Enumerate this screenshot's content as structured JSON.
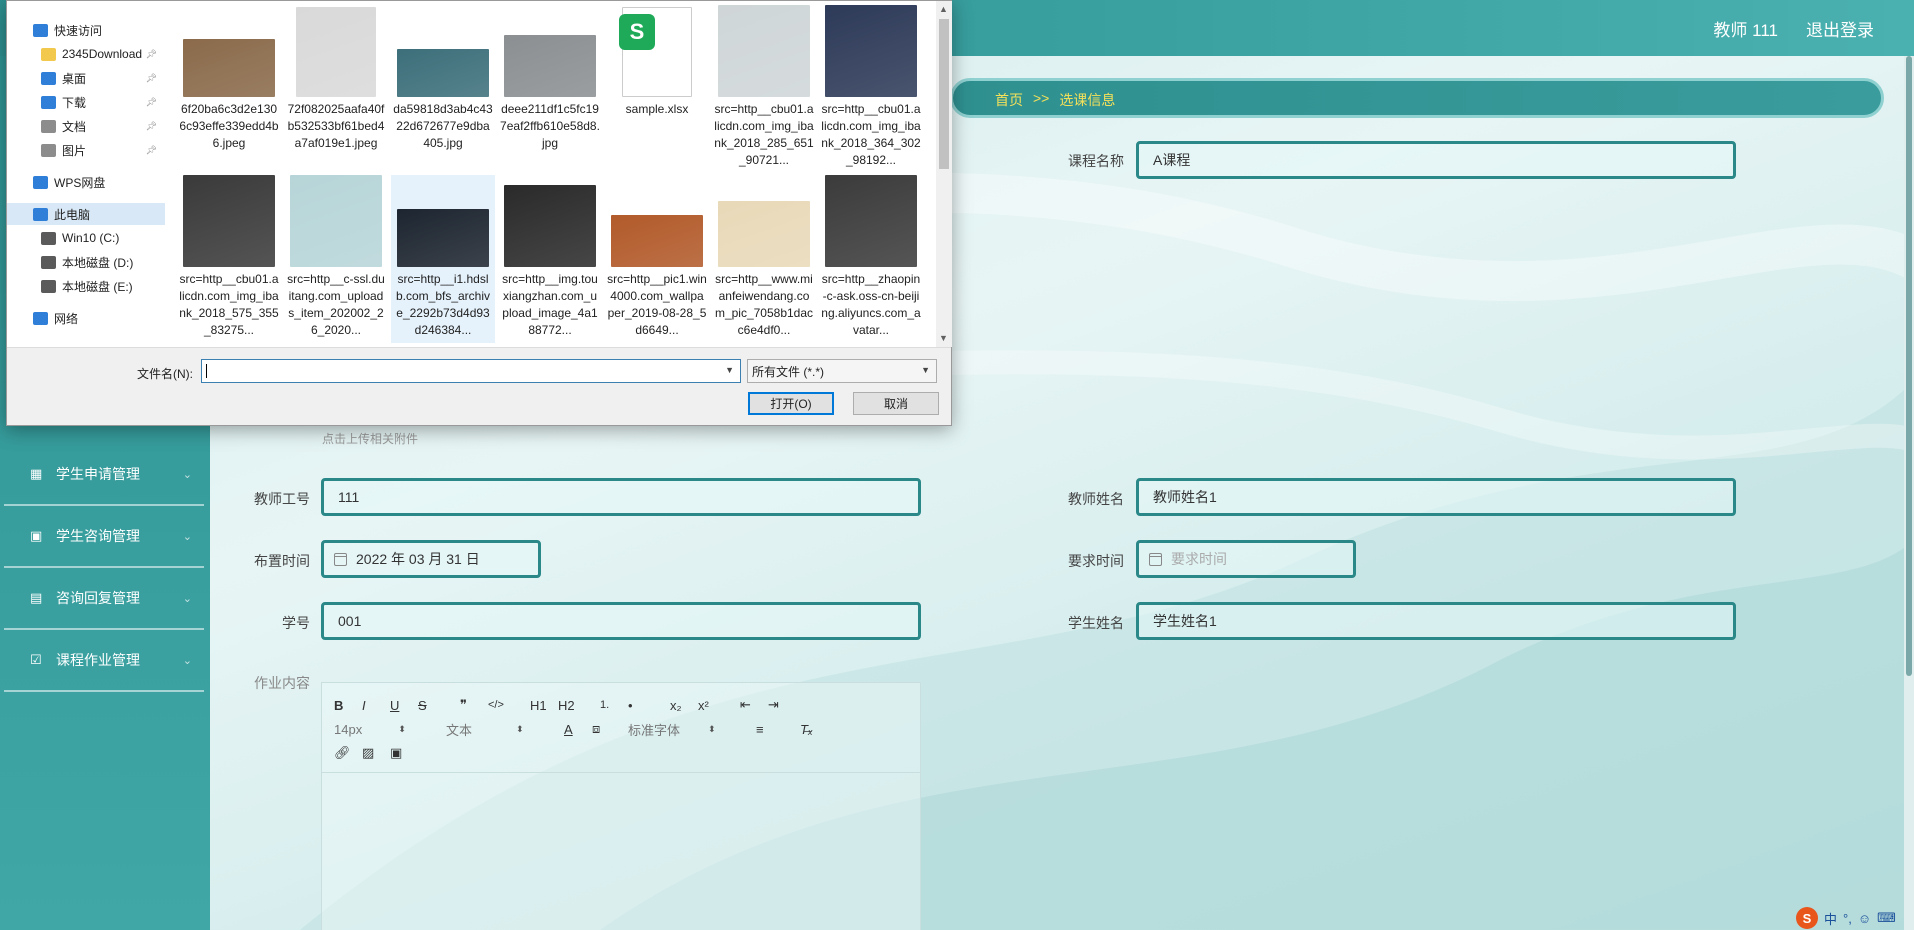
{
  "header": {
    "user_label": "教师 111",
    "logout_label": "退出登录"
  },
  "breadcrumb": {
    "home": "首页",
    "sep": ">>",
    "current": "选课信息"
  },
  "sidebar": {
    "items": [
      {
        "label": "学生申请管理"
      },
      {
        "label": "学生咨询管理"
      },
      {
        "label": "咨询回复管理"
      },
      {
        "label": "课程作业管理"
      }
    ]
  },
  "form": {
    "course_name_label": "课程名称",
    "course_name_value": "A课程",
    "upload_hint": "点击上传相关附件",
    "teacher_no_label": "教师工号",
    "teacher_no_value": "111",
    "teacher_name_label": "教师姓名",
    "teacher_name_value": "教师姓名1",
    "assign_time_label": "布置时间",
    "assign_time_value": "2022 年 03 月 31 日",
    "require_time_label": "要求时间",
    "require_time_placeholder": "要求时间",
    "student_no_label": "学号",
    "student_no_value": "001",
    "student_name_label": "学生姓名",
    "student_name_value": "学生姓名1",
    "content_label": "作业内容"
  },
  "editor": {
    "font_size": "14px",
    "text_type": "文本",
    "font_family": "标准字体",
    "buttons_row1": [
      "B",
      "I",
      "U",
      "S",
      "❞",
      "</>",
      "H1",
      "H2",
      "1.",
      "•",
      "x₂",
      "x²",
      "⇤",
      "⇥"
    ],
    "buttons_row3": [
      "link",
      "image",
      "video"
    ]
  },
  "dialog": {
    "nav": [
      {
        "label": "快速访问",
        "icon": "star-icon",
        "color": "#2f7ed8"
      },
      {
        "label": "2345Download",
        "icon": "folder-icon",
        "color": "#f2c94c",
        "pinned": true
      },
      {
        "label": "桌面",
        "icon": "desktop-icon",
        "color": "#2f7ed8",
        "pinned": true
      },
      {
        "label": "下载",
        "icon": "download-icon",
        "color": "#2f7ed8",
        "pinned": true
      },
      {
        "label": "文档",
        "icon": "document-icon",
        "color": "#8c8c8c",
        "pinned": true
      },
      {
        "label": "图片",
        "icon": "picture-icon",
        "color": "#8c8c8c",
        "pinned": true
      },
      {
        "label": "WPS网盘",
        "icon": "cloud-icon",
        "color": "#2f7ed8"
      },
      {
        "label": "此电脑",
        "icon": "computer-icon",
        "color": "#2f7ed8"
      },
      {
        "label": "Win10 (C:)",
        "icon": "drive-icon",
        "color": "#5a5a5a"
      },
      {
        "label": "本地磁盘 (D:)",
        "icon": "drive-icon",
        "color": "#5a5a5a"
      },
      {
        "label": "本地磁盘 (E:)",
        "icon": "drive-icon",
        "color": "#5a5a5a"
      },
      {
        "label": "网络",
        "icon": "network-icon",
        "color": "#2f7ed8"
      }
    ],
    "files": [
      {
        "name": "6f20ba6c3d2e1306c93effe339edd4b6.jpeg",
        "color": "#8a6a4a"
      },
      {
        "name": "72f082025aafa40fb532533bf61bed4a7af019e1.jpeg",
        "color": "#d9d9d9"
      },
      {
        "name": "da59818d3ab4c4322d672677e9dba405.jpg",
        "color": "#3c6f7a"
      },
      {
        "name": "deee211df1c5fc197eaf2ffb610e58d8.jpg",
        "color": "#8b8f92"
      },
      {
        "name": "sample.xlsx",
        "color": "#1faa59"
      },
      {
        "name": "src=http__cbu01.alicdn.com_img_ibank_2018_285_651_90721...",
        "color": "#cfd6d8"
      },
      {
        "name": "src=http__cbu01.alicdn.com_img_ibank_2018_364_302_98192...",
        "color": "#2d3a58"
      },
      {
        "name": "src=http__cbu01.alicdn.com_img_ibank_2018_575_355_83275...",
        "color": "#3a3a3a"
      },
      {
        "name": "src=http__c-ssl.duitang.com_uploads_item_202002_26_2020...",
        "color": "#b7d5d8"
      },
      {
        "name": "src=http__i1.hdslb.com_bfs_archive_2292b73d4d93d246384...",
        "color": "#1d2530"
      },
      {
        "name": "src=http__img.touxiangzhan.com_upload_image_4a188772...",
        "color": "#2a2a2a"
      },
      {
        "name": "src=http__pic1.win4000.com_wallpaper_2019-08-28_5d6649...",
        "color": "#b25a2a"
      },
      {
        "name": "src=http__www.mianfeiwendang.com_pic_7058b1dacc6e4df0...",
        "color": "#e8d9b8"
      },
      {
        "name": "src=http__zhaopin-c-ask.oss-cn-beijing.aliyuncs.com_avatar...",
        "color": "#3b3b3b"
      }
    ],
    "filename_label": "文件名(N):",
    "filename_value": "",
    "filetype_value": "所有文件 (*.*)",
    "open_label": "打开(O)",
    "cancel_label": "取消"
  },
  "ime": {
    "logo": "S",
    "mode": "中"
  },
  "colors": {
    "teal": "#2a8888",
    "crumb_text": "#f4e15a"
  }
}
